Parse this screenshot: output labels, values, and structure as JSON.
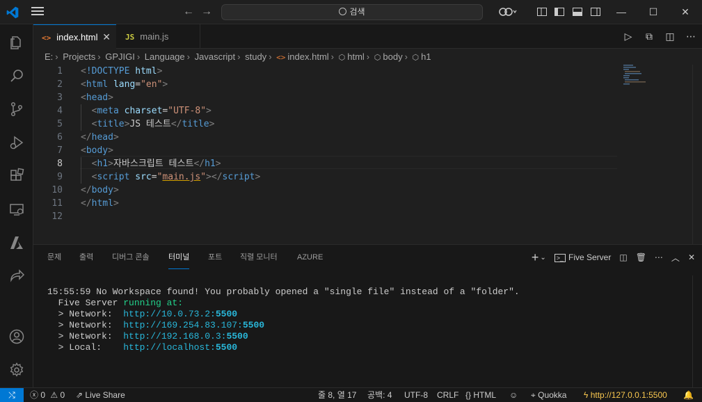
{
  "titlebar": {
    "search_placeholder": "검색",
    "back_icon": "arrow-left-icon",
    "forward_icon": "arrow-right-icon"
  },
  "tabs": [
    {
      "icon": "<>",
      "label": "index.html",
      "active": true
    },
    {
      "icon": "JS",
      "label": "main.js",
      "active": false
    }
  ],
  "breadcrumb": [
    "E:",
    "Projects",
    "GPJIGI",
    "Language",
    "Javascript",
    "study",
    "index.html",
    "html",
    "body",
    "h1"
  ],
  "editor": {
    "current_line": 8,
    "lines": [
      {
        "n": "1",
        "tokens": [
          [
            "t",
            "<"
          ],
          [
            "n",
            "!DOCTYPE "
          ],
          [
            "a",
            "html"
          ],
          [
            "t",
            ">"
          ]
        ]
      },
      {
        "n": "2",
        "tokens": [
          [
            "t",
            "<"
          ],
          [
            "n",
            "html "
          ],
          [
            "a",
            "lang"
          ],
          [
            "x",
            "="
          ],
          [
            "s",
            "\"en\""
          ],
          [
            "t",
            ">"
          ]
        ]
      },
      {
        "n": "3",
        "tokens": [
          [
            "t",
            "<"
          ],
          [
            "n",
            "head"
          ],
          [
            "t",
            ">"
          ]
        ]
      },
      {
        "n": "4",
        "tokens": [
          [
            "x",
            "  "
          ],
          [
            "t",
            "<"
          ],
          [
            "n",
            "meta "
          ],
          [
            "a",
            "charset"
          ],
          [
            "x",
            "="
          ],
          [
            "s",
            "\"UTF-8\""
          ],
          [
            "t",
            ">"
          ]
        ]
      },
      {
        "n": "5",
        "tokens": [
          [
            "x",
            "  "
          ],
          [
            "t",
            "<"
          ],
          [
            "n",
            "title"
          ],
          [
            "t",
            ">"
          ],
          [
            "x",
            "JS 테스트"
          ],
          [
            "t",
            "</"
          ],
          [
            "n",
            "title"
          ],
          [
            "t",
            ">"
          ]
        ]
      },
      {
        "n": "6",
        "tokens": [
          [
            "t",
            "</"
          ],
          [
            "n",
            "head"
          ],
          [
            "t",
            ">"
          ]
        ]
      },
      {
        "n": "7",
        "tokens": [
          [
            "t",
            "<"
          ],
          [
            "n",
            "body"
          ],
          [
            "t",
            ">"
          ]
        ]
      },
      {
        "n": "8",
        "tokens": [
          [
            "x",
            "  "
          ],
          [
            "t",
            "<"
          ],
          [
            "n",
            "h1"
          ],
          [
            "t",
            ">"
          ],
          [
            "x",
            "자바스크립트 테스트"
          ],
          [
            "t",
            "</"
          ],
          [
            "n",
            "h1"
          ],
          [
            "t",
            ">"
          ]
        ]
      },
      {
        "n": "9",
        "tokens": [
          [
            "x",
            "  "
          ],
          [
            "t",
            "<"
          ],
          [
            "n",
            "script "
          ],
          [
            "a",
            "src"
          ],
          [
            "x",
            "="
          ],
          [
            "s",
            "\""
          ],
          [
            "su",
            "main.js"
          ],
          [
            "s",
            "\""
          ],
          [
            "t",
            "></"
          ],
          [
            "n",
            "script"
          ],
          [
            "t",
            ">"
          ]
        ]
      },
      {
        "n": "10",
        "tokens": [
          [
            "t",
            "</"
          ],
          [
            "n",
            "body"
          ],
          [
            "t",
            ">"
          ]
        ]
      },
      {
        "n": "11",
        "tokens": [
          [
            "t",
            "</"
          ],
          [
            "n",
            "html"
          ],
          [
            "t",
            ">"
          ]
        ]
      },
      {
        "n": "12",
        "tokens": []
      }
    ]
  },
  "panel": {
    "tabs": [
      "문제",
      "출력",
      "디버그 콘솔",
      "터미널",
      "포트",
      "직렬 모니터",
      "AZURE"
    ],
    "active_tab": "터미널",
    "terminal_name": "Five Server",
    "terminal": {
      "line1": "15:55:59 No Workspace found! You probably opened a \"single file\" instead of a \"folder\".",
      "server_label": "  Five Server ",
      "running": "running at:",
      "entries": [
        {
          "label": "  > Network:  ",
          "url": "http://10.0.73.2:",
          "port": "5500"
        },
        {
          "label": "  > Network:  ",
          "url": "http://169.254.83.107:",
          "port": "5500"
        },
        {
          "label": "  > Network:  ",
          "url": "http://192.168.0.3:",
          "port": "5500"
        },
        {
          "label": "  > Local:    ",
          "url": "http://localhost:",
          "port": "5500"
        }
      ]
    }
  },
  "statusbar": {
    "errors": "0",
    "warnings": "0",
    "live_share": "Live Share",
    "position": "줄 8, 열 17",
    "spaces": "공백: 4",
    "encoding": "UTF-8",
    "eol": "CRLF",
    "language": "HTML",
    "quokka": "Quokka",
    "live_server": "http://127.0.0.1:5500"
  },
  "colors": {
    "accent": "#0078d4",
    "tag": "#569cd6",
    "attr": "#9cdcfe",
    "string": "#ce9178",
    "terminal_green": "#23d18b",
    "terminal_cyan": "#29b8db"
  }
}
